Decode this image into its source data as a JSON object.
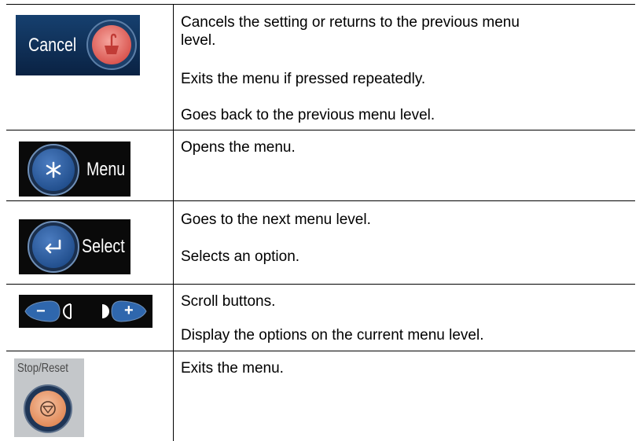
{
  "rows": [
    {
      "icon": {
        "name": "cancel-icon",
        "label": "Cancel"
      },
      "lines": [
        "Cancels the setting or returns to the previous menu",
        "level.",
        "Exits the menu if pressed repeatedly.",
        "Goes back to the previous menu level."
      ]
    },
    {
      "icon": {
        "name": "asterisk-icon",
        "label": "Menu"
      },
      "lines": [
        "Opens the menu."
      ]
    },
    {
      "icon": {
        "name": "enter-arrow-icon",
        "label": "Select"
      },
      "lines": [
        "Goes to the next menu level.",
        "Selects an option."
      ]
    },
    {
      "icon": {
        "name": "scroll-buttons-icon",
        "minus": "−",
        "plus": "+"
      },
      "lines": [
        "Scroll buttons.",
        "Display the options on the current menu level."
      ]
    },
    {
      "icon": {
        "name": "stop-icon",
        "label": "Stop/Reset"
      },
      "lines": [
        "Exits the menu."
      ]
    }
  ],
  "colors": {
    "panel_blue": "#0f2d56",
    "button_blue": "#2a5a9c",
    "cancel_red": "#e8706a",
    "panel_black": "#0a0a0a",
    "stop_panel": "#c4c7ca",
    "stop_orange": "#e8966a"
  }
}
